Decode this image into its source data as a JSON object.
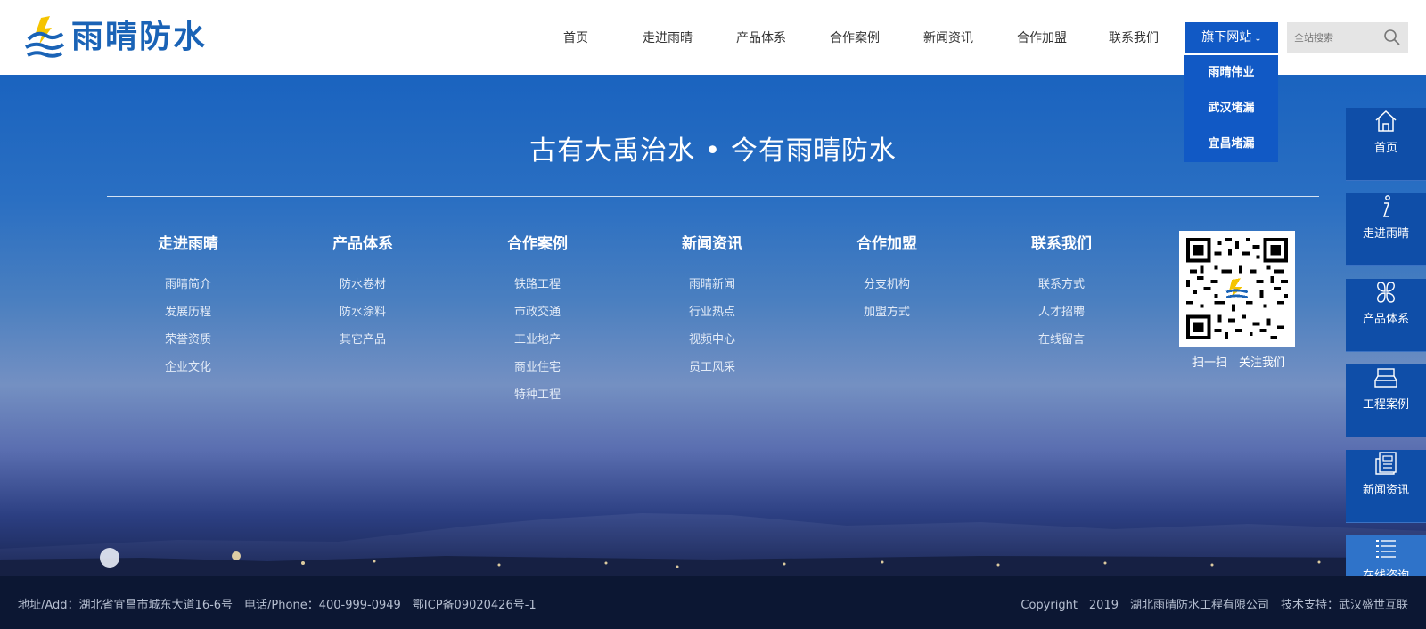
{
  "brand": {
    "name": "雨晴防水"
  },
  "nav": {
    "items": [
      "首页",
      "走进雨晴",
      "产品体系",
      "合作案例",
      "新闻资讯",
      "合作加盟",
      "联系我们"
    ],
    "sites_label": "旗下网站",
    "sites_menu": [
      "雨晴伟业",
      "武汉堵漏",
      "宜昌堵漏"
    ]
  },
  "search": {
    "placeholder": "全站搜索"
  },
  "hero": {
    "slogan": "古有大禹治水 • 今有雨晴防水"
  },
  "columns": [
    {
      "title": "走进雨晴",
      "links": [
        "雨晴简介",
        "发展历程",
        "荣誉资质",
        "企业文化"
      ]
    },
    {
      "title": "产品体系",
      "links": [
        "防水卷材",
        "防水涂料",
        "其它产品"
      ]
    },
    {
      "title": "合作案例",
      "links": [
        "铁路工程",
        "市政交通",
        "工业地产",
        "商业住宅",
        "特种工程"
      ]
    },
    {
      "title": "新闻资讯",
      "links": [
        "雨晴新闻",
        "行业热点",
        "视频中心",
        "员工风采"
      ]
    },
    {
      "title": "合作加盟",
      "links": [
        "分支机构",
        "加盟方式"
      ]
    },
    {
      "title": "联系我们",
      "links": [
        "联系方式",
        "人才招聘",
        "在线留言"
      ]
    }
  ],
  "qr": {
    "caption": "扫一扫　关注我们"
  },
  "sidebar": {
    "items": [
      {
        "label": "首页",
        "icon": "home-icon"
      },
      {
        "label": "走进雨晴",
        "icon": "info-icon"
      },
      {
        "label": "产品体系",
        "icon": "product-icon"
      },
      {
        "label": "工程案例",
        "icon": "case-icon"
      },
      {
        "label": "新闻资讯",
        "icon": "news-icon"
      },
      {
        "label": "在线咨询",
        "icon": "list-icon"
      }
    ]
  },
  "footer": {
    "left": "地址/Add：湖北省宜昌市城东大道16-6号　电话/Phone：400-999-0949　鄂ICP备09020426号-1",
    "right": "Copyright　2019　湖北雨晴防水工程有限公司　技术支持：武汉盛世互联"
  },
  "colors": {
    "brand_blue": "#1a63b6",
    "nav_active": "#1159c5",
    "sidebar": "#0f4ea8",
    "footer_bg": "#0c1733"
  }
}
